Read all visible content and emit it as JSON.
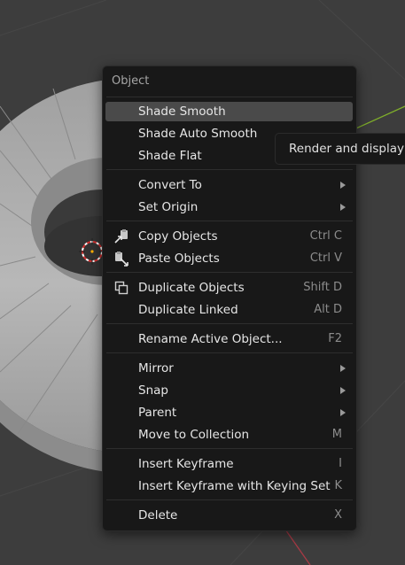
{
  "menu": {
    "title": "Object",
    "items": [
      {
        "label": "Shade Smooth"
      },
      {
        "label": "Shade Auto Smooth"
      },
      {
        "label": "Shade Flat"
      },
      {
        "label": "Convert To"
      },
      {
        "label": "Set Origin"
      },
      {
        "label": "Copy Objects",
        "shortcut": "Ctrl C"
      },
      {
        "label": "Paste Objects",
        "shortcut": "Ctrl V"
      },
      {
        "label": "Duplicate Objects",
        "shortcut": "Shift D"
      },
      {
        "label": "Duplicate Linked",
        "shortcut": "Alt D"
      },
      {
        "label": "Rename Active Object...",
        "shortcut": "F2"
      },
      {
        "label": "Mirror"
      },
      {
        "label": "Snap"
      },
      {
        "label": "Parent"
      },
      {
        "label": "Move to Collection",
        "shortcut": "M"
      },
      {
        "label": "Insert Keyframe",
        "shortcut": "I"
      },
      {
        "label": "Insert Keyframe with Keying Set",
        "shortcut": "K"
      },
      {
        "label": "Delete",
        "shortcut": "X"
      }
    ]
  },
  "tooltip": {
    "text": "Render and display f"
  },
  "icons": {
    "copy": "copy-objects-icon",
    "paste": "paste-objects-icon",
    "duplicate": "duplicate-icon",
    "cursor": "3d-cursor-icon"
  },
  "colors": {
    "menu_bg": "#181818",
    "highlight": "#4a4a4a",
    "viewport_bg": "#3d3d3d",
    "x_axis": "#a83a45",
    "y_axis": "#7fae2a"
  }
}
